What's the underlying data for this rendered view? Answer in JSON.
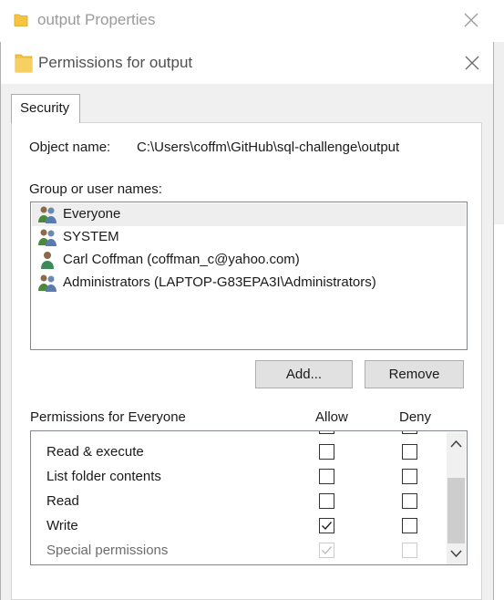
{
  "back_window": {
    "title": "output Properties",
    "icon": "folder-icon",
    "close_icon": "close-icon"
  },
  "dialog": {
    "title": "Permissions for output",
    "icon": "folder-icon",
    "close_icon": "close-icon"
  },
  "tabs": [
    {
      "label": "Security",
      "selected": true
    }
  ],
  "object_name": {
    "label": "Object name:",
    "value": "C:\\Users\\coffm\\GitHub\\sql-challenge\\output"
  },
  "groups": {
    "label": "Group or user names:",
    "items": [
      {
        "name": "Everyone",
        "icon": "group-icon",
        "selected": true
      },
      {
        "name": "SYSTEM",
        "icon": "group-icon",
        "selected": false
      },
      {
        "name": "Carl Coffman (coffman_c@yahoo.com)",
        "icon": "user-icon",
        "selected": false
      },
      {
        "name": "Administrators (LAPTOP-G83EPA3I\\Administrators)",
        "icon": "group-icon",
        "selected": false
      }
    ]
  },
  "buttons": {
    "add": "Add...",
    "remove": "Remove"
  },
  "permissions": {
    "label": "Permissions for Everyone",
    "allow_header": "Allow",
    "deny_header": "Deny",
    "rows": [
      {
        "name": "Read & execute",
        "allow": false,
        "deny": false,
        "disabled": false
      },
      {
        "name": "List folder contents",
        "allow": false,
        "deny": false,
        "disabled": false
      },
      {
        "name": "Read",
        "allow": false,
        "deny": false,
        "disabled": false
      },
      {
        "name": "Write",
        "allow": true,
        "deny": false,
        "disabled": false
      },
      {
        "name": "Special permissions",
        "allow": true,
        "deny": false,
        "disabled": true
      }
    ]
  },
  "colors": {
    "folder": "#f5c542",
    "selection": "#eeeeee",
    "button_bg": "#e1e1e1"
  }
}
